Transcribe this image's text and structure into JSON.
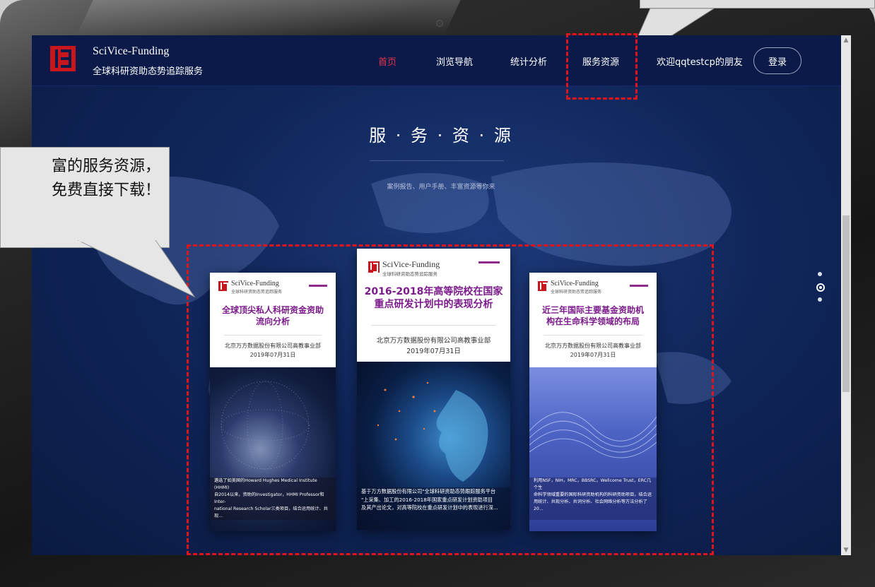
{
  "nav": {
    "brand_name": "SciVice-Funding",
    "brand_sub": "全球科研资助态势追踪服务",
    "items": [
      {
        "label": "首页",
        "active": true
      },
      {
        "label": "浏览导航"
      },
      {
        "label": "统计分析"
      },
      {
        "label": "服务资源"
      }
    ],
    "welcome": "欢迎qqtestcp的朋友",
    "login": "登录"
  },
  "section": {
    "title": "服 · 务 · 资 · 源",
    "subtitle": "案例报告、用户手册、丰富资源等你来"
  },
  "carousel": {
    "dots": 3,
    "active_dot": 2,
    "cards": [
      {
        "brand": "SciVice-Funding",
        "brand_sub": "全球科研资助态势追踪服务",
        "title_line1": "全球顶尖私人科研资金资助",
        "title_line2": "流向分析",
        "org": "北京万方数据股份有限公司高教事业部",
        "date": "2019年07月31日",
        "desc1": "遴选了如美国的Howard Hughes Medical Institute (HHMI)",
        "desc2": "自2014以来，资助的Investigator，HHMI Professor和Inter-",
        "desc3": "national Research Scholar三类项目，结合运用统计、共现..."
      },
      {
        "brand": "SciVice-Funding",
        "brand_sub": "全球科研资助态势追踪服务",
        "title_line1": "2016-2018年高等院校在国家",
        "title_line2": "重点研发计划中的表现分析",
        "org": "北京万方数据股份有限公司高教事业部",
        "date": "2019年07月31日",
        "desc1": "基于万方数据股份有限公司\"全球科研资助态势跟踪服务平台",
        "desc2": "\"上采集、加工的2016-2018年国家重点研发计划资助项目",
        "desc3": "及其产出论文，对高等院校在重点研发计划中的表现进行深..."
      },
      {
        "brand": "SciVice-Funding",
        "brand_sub": "全球科研资助态势追踪服务",
        "title_line1": "近三年国际主要基金资助机",
        "title_line2": "构在生命科学领域的布局",
        "org": "北京万方数据股份有限公司高教事业部",
        "date": "2019年07月31日",
        "desc1": "利用NSF，NIH，MRC，BBSRC，Wellcome Trust，ERC几个生",
        "desc2": "命科学领域重要的国际科研资助机构的科研资助项目，结合运",
        "desc3": "用统计、共现分析、共词分析、社会网络分析等方法分析了20..."
      }
    ]
  },
  "callout": {
    "line1": "富的服务资源，",
    "line2": "免费直接下载！"
  },
  "colors": {
    "accent_red": "#e0141b",
    "title_purple": "#7b1a8a",
    "nav_bg": "#0b1a48",
    "active_nav": "#e2344c"
  },
  "icons": [
    "logo-icon",
    "carousel-dot-icon",
    "scroll-up-icon",
    "scroll-down-icon"
  ]
}
